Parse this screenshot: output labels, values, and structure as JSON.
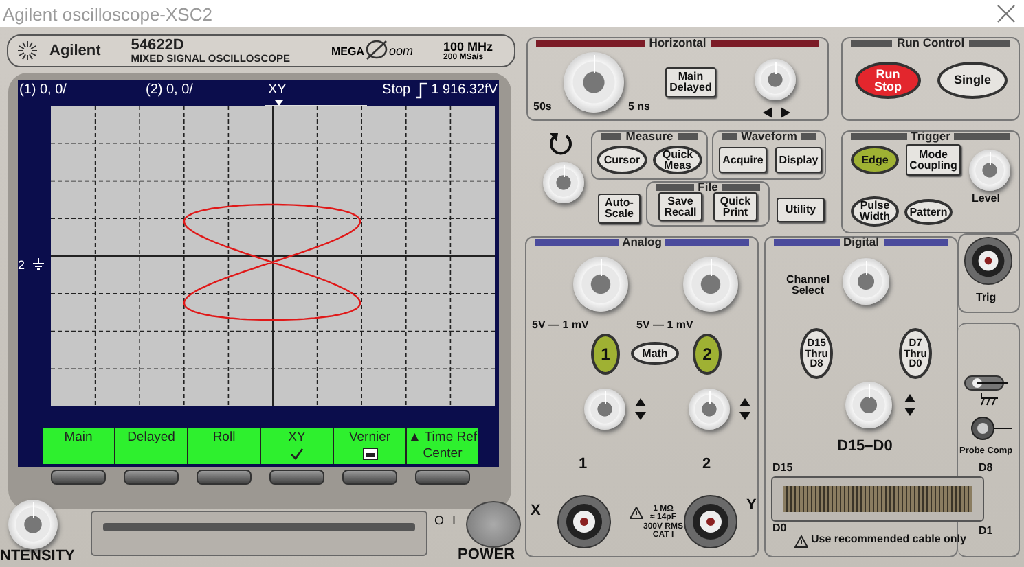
{
  "window": {
    "title": "Agilent oscilloscope-XSC2"
  },
  "header": {
    "brand": "Agilent",
    "model": "54622D",
    "description": "MIXED SIGNAL OSCILLOSCOPE",
    "logo_left": "MEGA",
    "logo_right": "oom",
    "bandwidth": "100 MHz",
    "sample_rate": "200 MSa/s"
  },
  "screen": {
    "status": {
      "channel_1": "(1) 0, 0/",
      "channel_2": "(2) 0, 0/",
      "mode": "XY",
      "run_state": "Stop",
      "trigger_level": "1 916.32fV"
    },
    "channel_marker": "2",
    "softkeys": [
      {
        "label": "Main",
        "kind": "plain"
      },
      {
        "label": "Delayed",
        "kind": "plain"
      },
      {
        "label": "Roll",
        "kind": "plain"
      },
      {
        "label": "XY",
        "kind": "toggle",
        "checked": true
      },
      {
        "label": "Vernier",
        "kind": "toggle",
        "checked": false
      },
      {
        "label": "▲ Time Ref",
        "kind": "menu",
        "value": "Center"
      }
    ]
  },
  "front_panel": {
    "intensity_label": "NTENSITY",
    "power_off": "O",
    "power_on": "I",
    "power_label": "POWER"
  },
  "horizontal": {
    "title": "Horizontal",
    "slow_label": "50s",
    "fast_label": "5 ns",
    "buttons": [
      {
        "label": "Main\nDelayed",
        "kind": "key"
      }
    ]
  },
  "run_control": {
    "title": "Run Control",
    "buttons": [
      {
        "label": "Run\nStop",
        "kind": "oval",
        "color": "#e3262d"
      },
      {
        "label": "Single",
        "kind": "oval"
      }
    ]
  },
  "measure": {
    "title": "Measure",
    "buttons": [
      {
        "label": "Cursor",
        "kind": "oval"
      },
      {
        "label": "Quick\nMeas",
        "kind": "oval"
      }
    ]
  },
  "waveform": {
    "title": "Waveform",
    "buttons": [
      {
        "label": "Acquire",
        "kind": "key"
      },
      {
        "label": "Display",
        "kind": "key"
      }
    ]
  },
  "file": {
    "title": "File",
    "buttons": [
      {
        "label": "Save\nRecall",
        "kind": "key"
      },
      {
        "label": "Quick\nPrint",
        "kind": "key"
      }
    ]
  },
  "auto_scale": {
    "label": "Auto-\nScale",
    "kind": "key"
  },
  "utility": {
    "label": "Utility",
    "kind": "key"
  },
  "trigger": {
    "title": "Trigger",
    "buttons": [
      {
        "label": "Edge",
        "kind": "oval",
        "color": "#9fb133"
      },
      {
        "label": "Mode\nCoupling",
        "kind": "key"
      },
      {
        "label": "Pulse\nWidth",
        "kind": "oval"
      },
      {
        "label": "Pattern",
        "kind": "oval"
      }
    ],
    "level_label": "Level",
    "input_label": "Trig"
  },
  "analog": {
    "title": "Analog",
    "scale_labels": [
      "5V — 1 mV",
      "5V — 1 mV"
    ],
    "buttons": [
      {
        "label": "1",
        "kind": "tall",
        "color": "#9fb133"
      },
      {
        "label": "Math",
        "kind": "oval"
      },
      {
        "label": "2",
        "kind": "tall",
        "color": "#9fb133"
      }
    ],
    "inputs": [
      {
        "number": "1",
        "axis": "X"
      },
      {
        "number": "2",
        "axis": "Y"
      }
    ],
    "warning": "1 MΩ\n≈ 14pF\n300V RMS\nCAT I"
  },
  "digital": {
    "title": "Digital",
    "select_label": "Channel\nSelect",
    "buttons": [
      {
        "label": "D15\nThru\nD8",
        "kind": "tall"
      },
      {
        "label": "D7\nThru\nD0",
        "kind": "tall"
      }
    ],
    "position_label": "D15–D0",
    "connector_labels": [
      "D15",
      "D8",
      "D0",
      "D1"
    ],
    "notice": "Use recommended cable only"
  },
  "probe_comp_label": "Probe Comp"
}
